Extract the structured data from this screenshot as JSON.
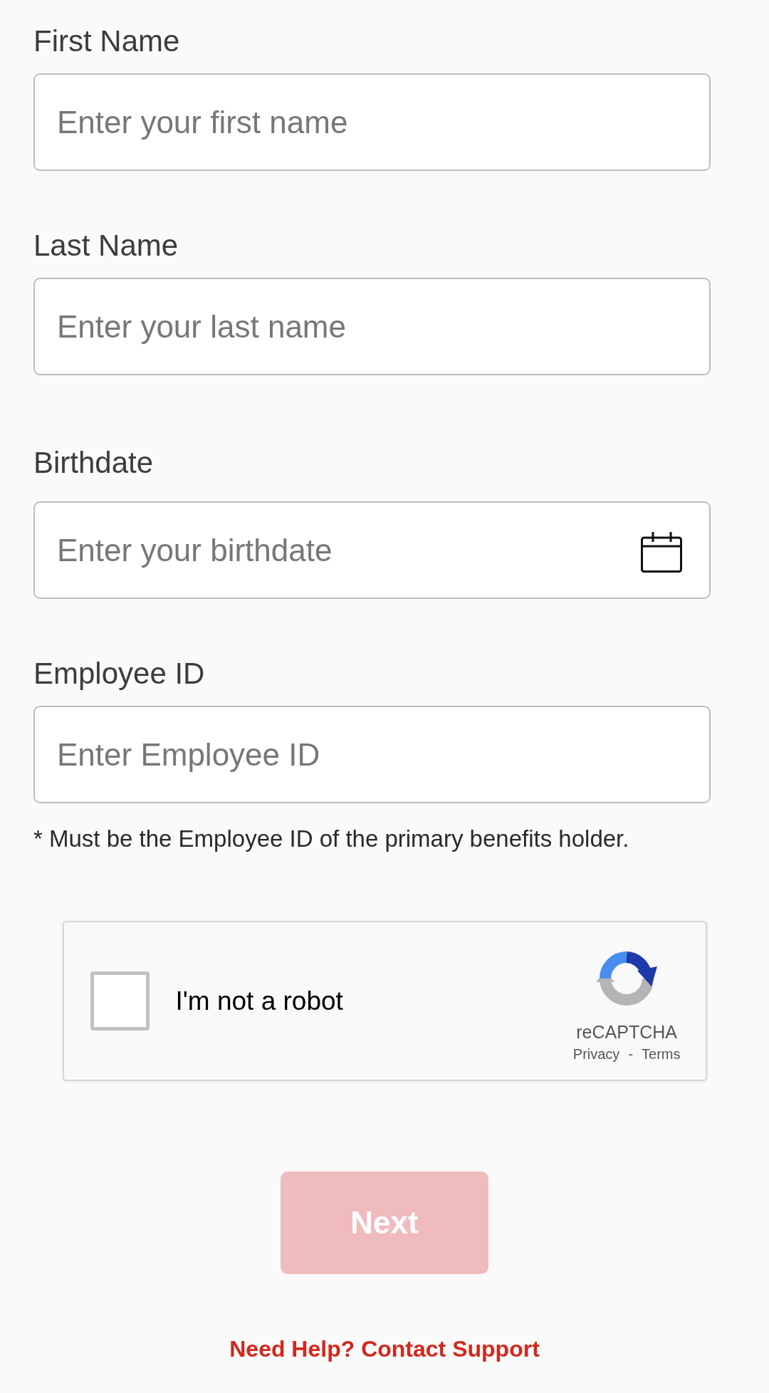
{
  "fields": [
    {
      "label": "First Name",
      "placeholder": "Enter your first name",
      "kind": "text"
    },
    {
      "label": "Last Name",
      "placeholder": "Enter your last name",
      "kind": "text"
    },
    {
      "label": "Birthdate",
      "placeholder": "Enter your birthdate",
      "kind": "date"
    },
    {
      "label": "Employee ID",
      "placeholder": "Enter Employee ID",
      "kind": "text",
      "note": "* Must be the Employee ID of the primary benefits holder."
    }
  ],
  "captcha": {
    "label": "I'm not a robot",
    "checked": false,
    "brand": "reCAPTCHA",
    "links": [
      "Privacy",
      "Terms"
    ],
    "separator": "-"
  },
  "next_button": {
    "label": "Next",
    "disabled": true
  },
  "help_link": "Need Help? Contact Support"
}
